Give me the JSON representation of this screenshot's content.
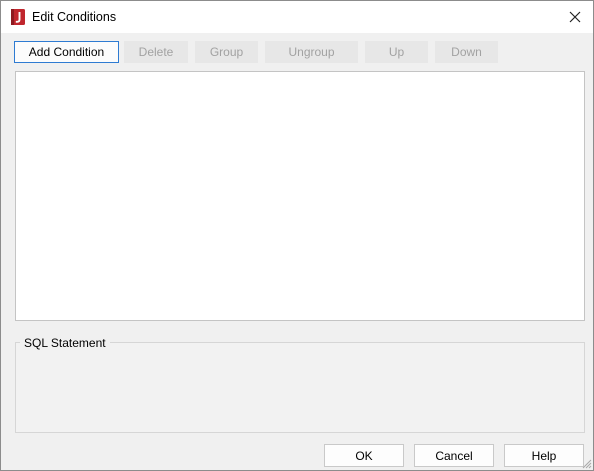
{
  "window": {
    "title": "Edit Conditions",
    "app_icon": "j-app-icon",
    "accent_color": "#c0262d"
  },
  "toolbar": {
    "add_condition": "Add Condition",
    "delete": "Delete",
    "group": "Group",
    "ungroup": "Ungroup",
    "up": "Up",
    "down": "Down"
  },
  "sql": {
    "legend": "SQL Statement",
    "statement": ""
  },
  "footer": {
    "ok": "OK",
    "cancel": "Cancel",
    "help": "Help"
  },
  "colors": {
    "focus_border": "#2e7bd2",
    "disabled_text": "#a2a2a2",
    "dialog_background": "#f0f0f0"
  }
}
